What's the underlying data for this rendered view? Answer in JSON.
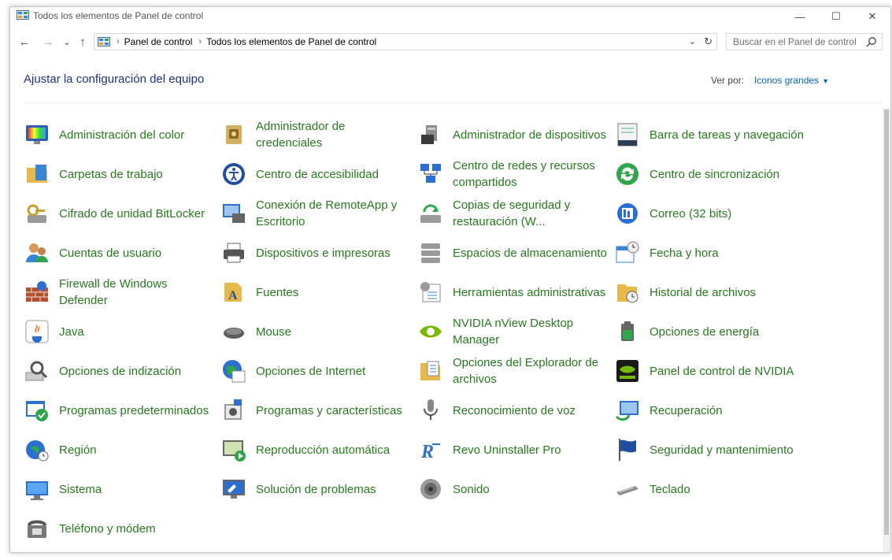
{
  "window": {
    "title": "Todos los elementos de Panel de control",
    "min_glyph": "—",
    "max_glyph": "☐",
    "close_glyph": "✕"
  },
  "nav": {
    "back_glyph": "←",
    "forward_glyph": "→",
    "recent_glyph": "⌄",
    "up_glyph": "↑",
    "breadcrumbs": [
      "Panel de control",
      "Todos los elementos de Panel de control"
    ],
    "dropdown_glyph": "⌄",
    "refresh_glyph": "↻",
    "search_placeholder": "Buscar en el Panel de control"
  },
  "header": {
    "title": "Ajustar la configuración del equipo",
    "view_by_label": "Ver por:",
    "view_by_value": "Iconos grandes"
  },
  "items": [
    {
      "label": "Administración del color",
      "icon": "color-management-icon"
    },
    {
      "label": "Administrador de credenciales",
      "icon": "credential-manager-icon"
    },
    {
      "label": "Administrador de dispositivos",
      "icon": "device-manager-icon"
    },
    {
      "label": "Barra de tareas y navegación",
      "icon": "taskbar-icon"
    },
    {
      "label": "Carpetas de trabajo",
      "icon": "work-folders-icon"
    },
    {
      "label": "Centro de accesibilidad",
      "icon": "accessibility-icon"
    },
    {
      "label": "Centro de redes y recursos compartidos",
      "icon": "network-center-icon"
    },
    {
      "label": "Centro de sincronización",
      "icon": "sync-center-icon"
    },
    {
      "label": "Cifrado de unidad BitLocker",
      "icon": "bitlocker-icon"
    },
    {
      "label": "Conexión de RemoteApp y Escritorio",
      "icon": "remoteapp-icon"
    },
    {
      "label": "Copias de seguridad y restauración (W...",
      "icon": "backup-icon"
    },
    {
      "label": "Correo (32 bits)",
      "icon": "mail-icon"
    },
    {
      "label": "Cuentas de usuario",
      "icon": "user-accounts-icon"
    },
    {
      "label": "Dispositivos e impresoras",
      "icon": "printers-icon"
    },
    {
      "label": "Espacios de almacenamiento",
      "icon": "storage-spaces-icon"
    },
    {
      "label": "Fecha y hora",
      "icon": "date-time-icon"
    },
    {
      "label": "Firewall de Windows Defender",
      "icon": "firewall-icon"
    },
    {
      "label": "Fuentes",
      "icon": "fonts-icon"
    },
    {
      "label": "Herramientas administrativas",
      "icon": "admin-tools-icon"
    },
    {
      "label": "Historial de archivos",
      "icon": "file-history-icon"
    },
    {
      "label": "Java",
      "icon": "java-icon"
    },
    {
      "label": "Mouse",
      "icon": "mouse-icon"
    },
    {
      "label": "NVIDIA nView Desktop Manager",
      "icon": "nvidia-nview-icon"
    },
    {
      "label": "Opciones de energía",
      "icon": "power-options-icon"
    },
    {
      "label": "Opciones de indización",
      "icon": "indexing-icon"
    },
    {
      "label": "Opciones de Internet",
      "icon": "internet-options-icon"
    },
    {
      "label": "Opciones del Explorador de archivos",
      "icon": "explorer-options-icon"
    },
    {
      "label": "Panel de control de NVIDIA",
      "icon": "nvidia-panel-icon"
    },
    {
      "label": "Programas predeterminados",
      "icon": "default-programs-icon"
    },
    {
      "label": "Programas y características",
      "icon": "programs-features-icon"
    },
    {
      "label": "Reconocimiento de voz",
      "icon": "microphone-icon"
    },
    {
      "label": "Recuperación",
      "icon": "recovery-icon"
    },
    {
      "label": "Región",
      "icon": "region-icon"
    },
    {
      "label": "Reproducción automática",
      "icon": "autoplay-icon"
    },
    {
      "label": "Revo Uninstaller Pro",
      "icon": "revo-uninstaller-icon"
    },
    {
      "label": "Seguridad y mantenimiento",
      "icon": "security-flag-icon"
    },
    {
      "label": "Sistema",
      "icon": "system-icon"
    },
    {
      "label": "Solución de problemas",
      "icon": "troubleshooting-icon"
    },
    {
      "label": "Sonido",
      "icon": "sound-icon"
    },
    {
      "label": "Teclado",
      "icon": "keyboard-icon"
    },
    {
      "label": "Teléfono y módem",
      "icon": "phone-modem-icon"
    }
  ]
}
